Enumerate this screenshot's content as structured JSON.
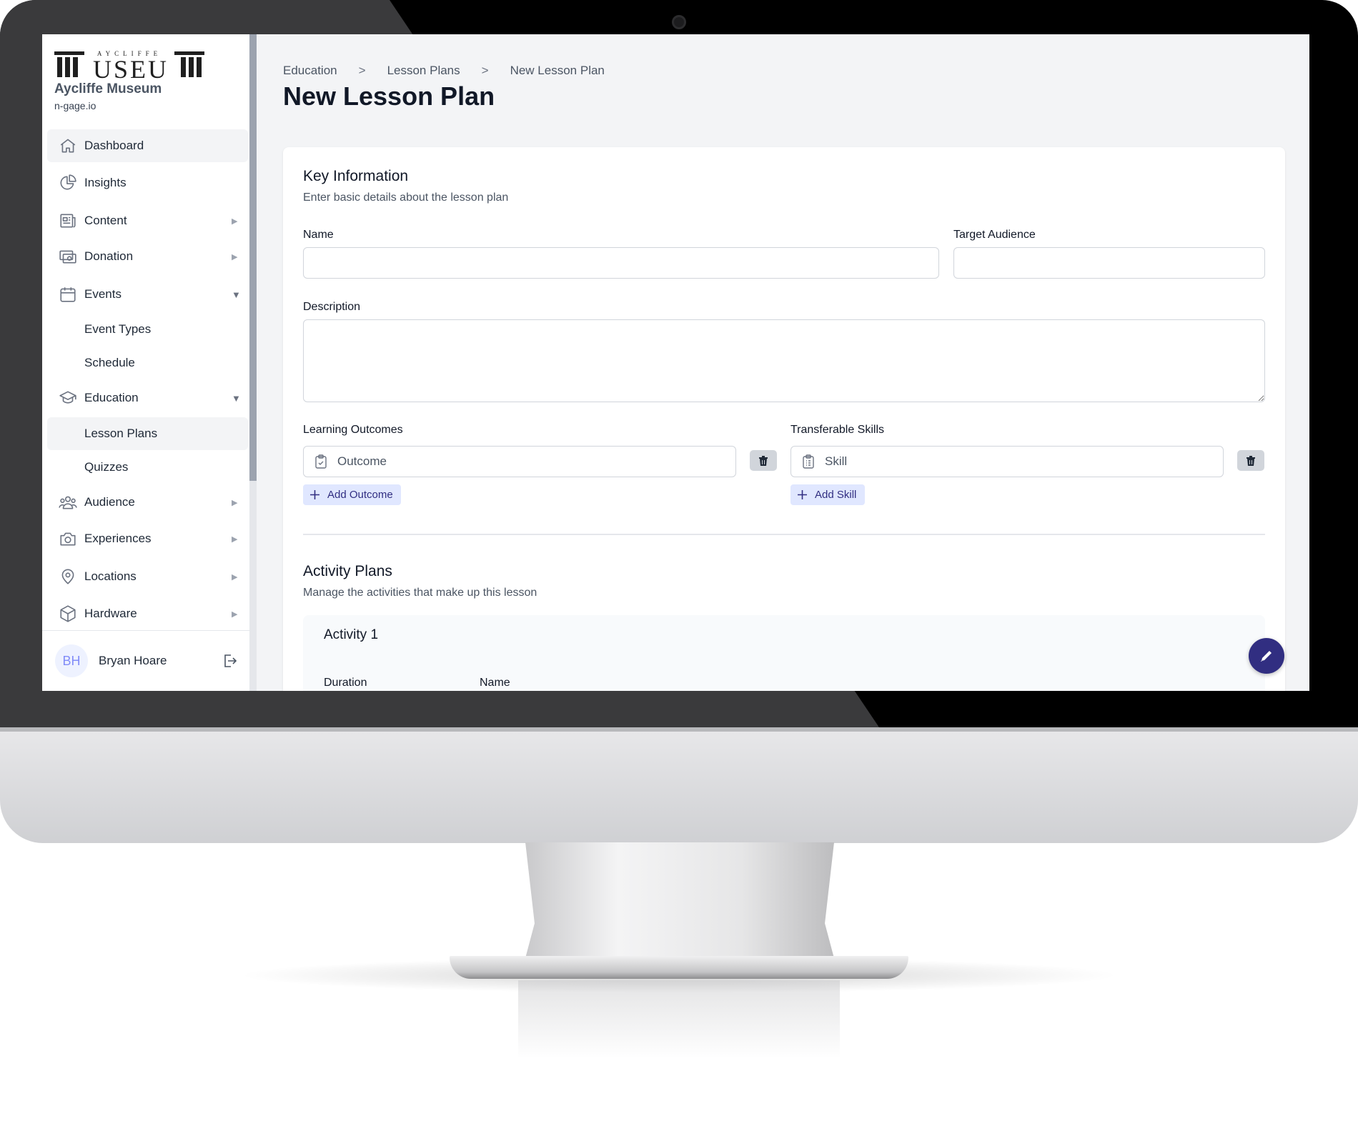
{
  "brand": {
    "logo_text_top": "AYCLIFFE",
    "logo_text_main": "MUSEUM",
    "org_name": "Aycliffe Museum",
    "site": "n-gage.io"
  },
  "sidebar": {
    "items": [
      {
        "label": "Dashboard",
        "icon": "home-icon",
        "active": true
      },
      {
        "label": "Insights",
        "icon": "pie-chart-icon"
      },
      {
        "label": "Content",
        "icon": "newspaper-icon",
        "arrow": "right"
      },
      {
        "label": "Donation",
        "icon": "cash-icon",
        "arrow": "right"
      },
      {
        "label": "Events",
        "icon": "calendar-icon",
        "arrow": "down"
      },
      {
        "label": "Event Types",
        "sub": true
      },
      {
        "label": "Schedule",
        "sub": true
      },
      {
        "label": "Education",
        "icon": "graduation-cap-icon",
        "arrow": "down"
      },
      {
        "label": "Lesson Plans",
        "sub": true,
        "active": true
      },
      {
        "label": "Quizzes",
        "sub": true
      },
      {
        "label": "Audience",
        "icon": "user-group-icon",
        "arrow": "right"
      },
      {
        "label": "Experiences",
        "icon": "camera-icon",
        "arrow": "right"
      },
      {
        "label": "Locations",
        "icon": "map-pin-icon",
        "arrow": "right"
      },
      {
        "label": "Hardware",
        "icon": "cube-icon",
        "arrow": "right"
      }
    ],
    "user": {
      "initials": "BH",
      "name": "Bryan Hoare"
    }
  },
  "breadcrumb": [
    "Education",
    "Lesson Plans",
    "New Lesson Plan"
  ],
  "breadcrumb_sep": ">",
  "page_title": "New Lesson Plan",
  "key_info": {
    "title": "Key Information",
    "subtitle": "Enter basic details about the lesson plan",
    "name_label": "Name",
    "name_value": "",
    "audience_label": "Target Audience",
    "audience_value": "",
    "description_label": "Description",
    "description_value": "",
    "outcomes_label": "Learning Outcomes",
    "outcome_placeholder": "Outcome",
    "add_outcome": "Add Outcome",
    "skills_label": "Transferable Skills",
    "skill_placeholder": "Skill",
    "add_skill": "Add Skill"
  },
  "activity_plans": {
    "title": "Activity Plans",
    "subtitle": "Manage the activities that make up this lesson",
    "activities": [
      {
        "title": "Activity 1",
        "duration_label": "Duration",
        "name_label": "Name"
      }
    ]
  },
  "colors": {
    "accent": "#312e81",
    "accent_light": "#e0e7ff",
    "background": "#f3f4f6"
  }
}
